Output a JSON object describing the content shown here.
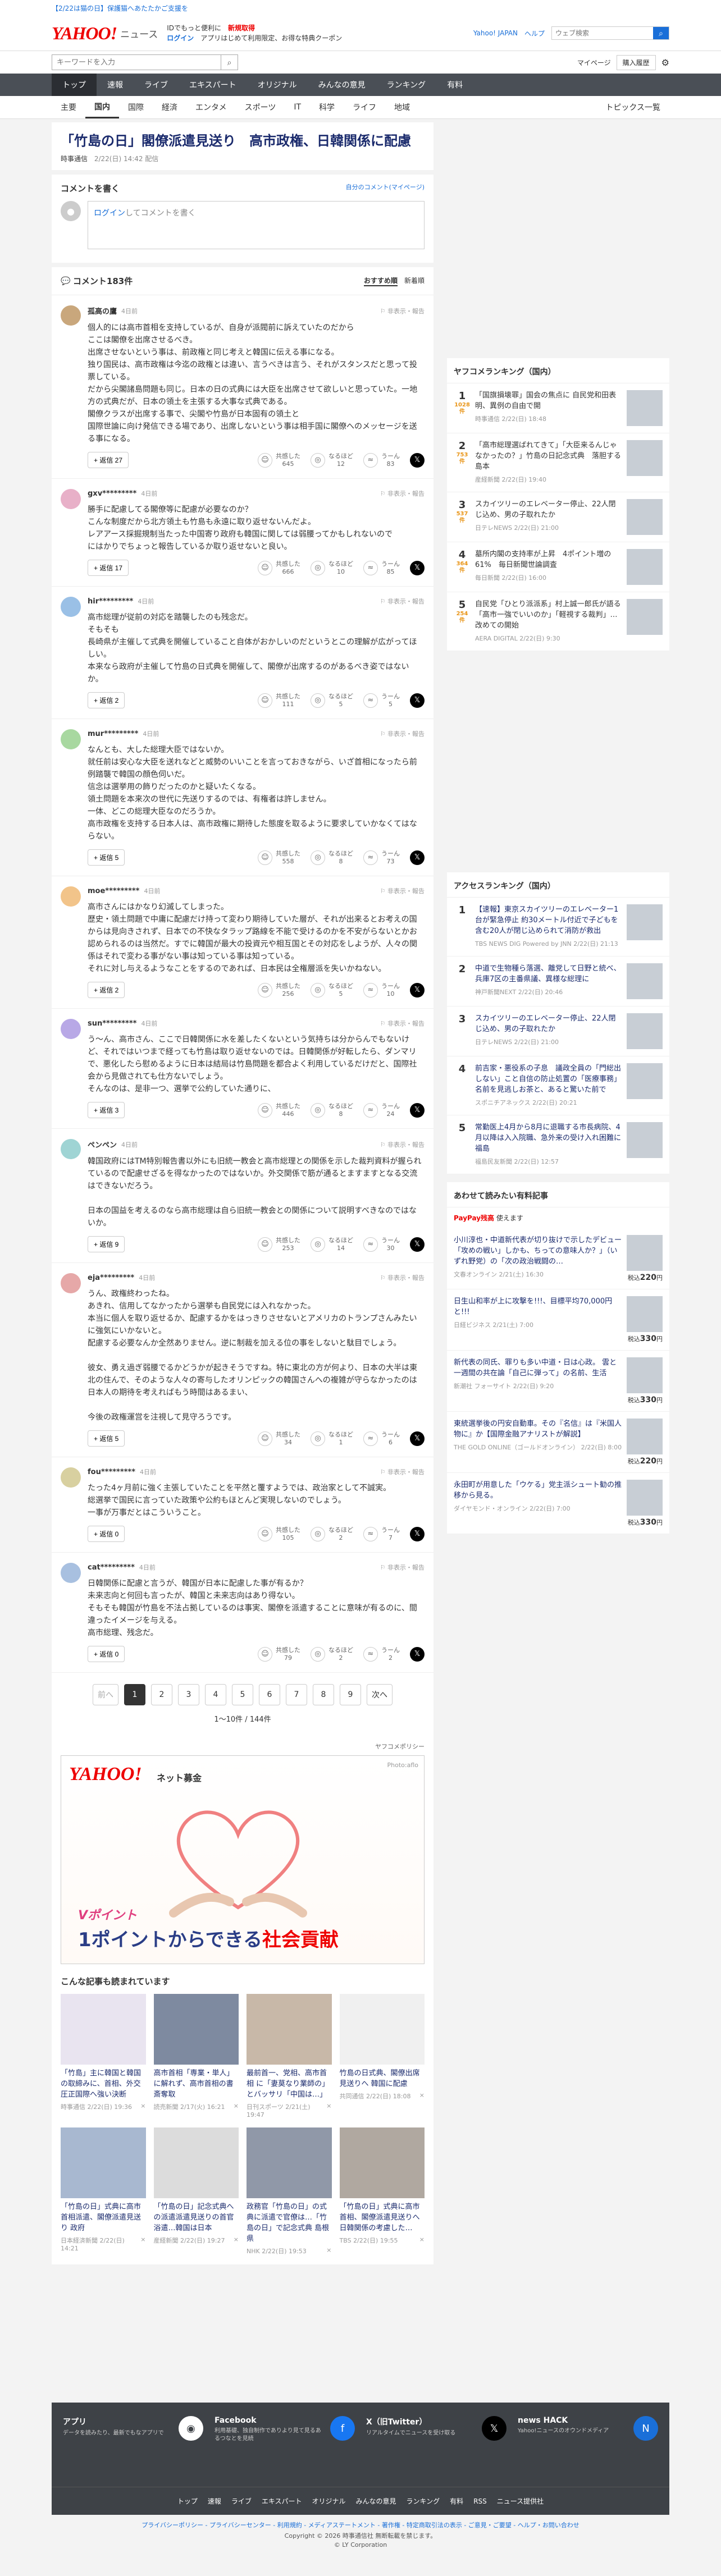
{
  "topstrip": {
    "notice": "【2/22は猫の日】保護猫へあたたかご支援を"
  },
  "header": {
    "logo": "YAHOO!",
    "logo_sub": "ニュース",
    "msg1": "IDでもっと便利に",
    "new_reg": "新規取得",
    "login": "ログイン",
    "msg2": "アプリはじめて利用限定、お得な特典クーポン",
    "yj": "Yahoo! JAPAN",
    "help": "ヘルプ",
    "search_placeholder": "ウェブ検索",
    "search_btn": "検索"
  },
  "subbar": {
    "search_placeholder": "キーワードを入力",
    "mypage": "マイページ",
    "subscribe": "購入履歴"
  },
  "catnav": [
    "トップ",
    "速報",
    "ライブ",
    "エキスパート",
    "オリジナル",
    "みんなの意見",
    "ランキング",
    "有料"
  ],
  "subnav": [
    "主要",
    "国内",
    "国際",
    "経済",
    "エンタメ",
    "スポーツ",
    "IT",
    "科学",
    "ライフ",
    "地域"
  ],
  "subnav_right": "トピックス一覧",
  "article": {
    "title": "「竹島の日」閣僚派遣見送り　高市政権、日韓関係に配慮",
    "source": "時事通信",
    "date": "2/22(日) 14:42 配信"
  },
  "write": {
    "title": "コメントを書く",
    "policy": "自分のコメント(マイページ)",
    "login_link": "ログイン",
    "placeholder": "してコメントを書く"
  },
  "comments_head": {
    "title": "コメント183件",
    "sort1": "おすすめ順",
    "sort2": "新着順"
  },
  "comments": [
    {
      "name": "孤高の鷹",
      "time": "4日前",
      "flag": "非表示・報告",
      "text": "個人的には高市首相を支持しているが、自身が派閥前に訴えていたのだから\nここは閣僚を出席させるべき。\n出席させないという事は、前政権と同じ考えと韓国に伝える事になる。\n独り国民は、高市政権は今迄の政権とは違い、言うべきは言う、それがスタンスだと思って投票している。\nだから尖閣諸島問題も同じ。日本の日の式典には大臣を出席させて欲しいと思っていた。一地方の式典だが、日本の領土を主張する大事な式典である。\n閣僚クラスが出席する事で、尖閣や竹島が日本固有の領土と\n国際世論に向け発信できる場であり、出席しないという事は相手国に閣僚へのメッセージを送る事になる。",
      "replies": "返信 27",
      "r1": "共感した",
      "c1": "645",
      "r2": "なるほど",
      "c2": "12",
      "r3": "うーん",
      "c3": "83"
    },
    {
      "name": "gxv*********",
      "time": "4日前",
      "flag": "非表示・報告",
      "text": "勝手に配慮してる閣僚等に配慮が必要なのか？\nこんな制度だから北方領土も竹島も永遠に取り返せないんだよ。\nレアアース採掘規制当たった中国寄り政府も韓国に関しては弱腰ってかもしれないので\nにはかりでちょっと報告しているか取り返せないと良い。",
      "replies": "返信 17",
      "r1": "共感した",
      "c1": "666",
      "r2": "なるほど",
      "c2": "10",
      "r3": "うーん",
      "c3": "85"
    },
    {
      "name": "hir*********",
      "time": "4日前",
      "flag": "非表示・報告",
      "text": "高市総理が従前の対応を踏襲したのも残念だ。\nそもそも\n長崎県が主催して式典を開催していること自体がおかしいのだというとこの理解が広がってほしい。\n本来なら政府が主催して竹島の日式典を開催して、閣僚が出席するのがあるべき姿ではないか。",
      "replies": "返信 2",
      "r1": "共感した",
      "c1": "111",
      "r2": "なるほど",
      "c2": "5",
      "r3": "うーん",
      "c3": "5"
    },
    {
      "name": "mur*********",
      "time": "4日前",
      "flag": "非表示・報告",
      "text": "なんとも、大した総理大臣ではないか。\n就任前は安心な大臣を送れなどと威勢のいいことを言っておきながら、いざ首相になったら前例踏襲で韓国の顔色伺いだ。\n信念は選挙用の飾りだったのかと疑いたくなる。\n領土問題を本来次の世代に先送りするのでは、有権者は許しません。\n一体、どこの総理大臣なのだろうか。\n高市政権を支持する日本人は、高市政権に期待した態度を取るように要求していかなくてはならない。",
      "replies": "返信 5",
      "r1": "共感した",
      "c1": "558",
      "r2": "なるほど",
      "c2": "8",
      "r3": "うーん",
      "c3": "73"
    },
    {
      "name": "moe*********",
      "time": "4日前",
      "flag": "非表示・報告",
      "text": "高市さんにはかなり幻滅してしまった。\n歴史・領土問題で中庸に配慮だけ持って変わり期待していた層が、それが出来るとお考えの国からは見向きされず、日本での不快なタラップ路線を不能で受けるのかを不安がらないとかお認められるのは当然だ。すでに韓国が最大の投資元や相互国とその対応をしようが、人々の関係はそれで変わる事がない事は知っている事は知っている。\nそれに対し与えるようなことをするのであれば、日本民は全権層派を失いかねない。",
      "replies": "返信 2",
      "r1": "共感した",
      "c1": "256",
      "r2": "なるほど",
      "c2": "5",
      "r3": "うーん",
      "c3": "10"
    },
    {
      "name": "sun*********",
      "time": "4日前",
      "flag": "非表示・報告",
      "text": "う〜ん、高市さん、ここで日韓関係に水を差したくないという気持ちは分からんでもないけど、それではいつまで経っても竹島は取り返せないのでは。日韓関係が好転したら、ダンマリで、悪化したら慰めるように日本は結局は竹島問題を都合よく利用しているだけだと、国際社会から見做されても仕方ないでしょう。\nそんなのは、是非一つ、選挙で公約していた通りに、",
      "replies": "返信 3",
      "r1": "共感した",
      "c1": "446",
      "r2": "なるほど",
      "c2": "8",
      "r3": "うーん",
      "c3": "24"
    },
    {
      "name": "ペンペン",
      "time": "4日前",
      "flag": "非表示・報告",
      "text": "韓国政府にはTM特別報告書以外にも旧統一教会と高市総理との関係を示した裁判資料が握られているので配慮せざるを得なかったのではないか。外交関係で筋が通るとますますとなる交流はできないだろう。\n\n日本の国益を考えるのなら高市総理は自ら旧統一教会との関係について説明すべきなのではないか。",
      "replies": "返信 9",
      "r1": "共感した",
      "c1": "253",
      "r2": "なるほど",
      "c2": "14",
      "r3": "うーん",
      "c3": "30"
    },
    {
      "name": "eja*********",
      "time": "4日前",
      "flag": "非表示・報告",
      "text": "うん、政権終わったね。\nあきれ、信用してなかったから選挙も自民党には入れなかった。\n本当に個人を取り返せるか、配慮するかをはっきりさせないとアメリカのトランプさんみたいに強気にいかないと。\n配慮する必要なんか全然ありません。逆に制裁を加える位の事をしないと駄目でしょう。\n\n彼女、勇え過ぎ弱腰でるかどうかが起きそうですね。特に東北の方が何より、日本の大半は東北の住んで、そのような人々の寄与したオリンピックの韓国さんへの複雑が守らなかったのは日本人の期待を考えればもう時間はあるまい、\n\n今後の政権運営を注視して見守ろうです。",
      "replies": "返信 5",
      "r1": "共感した",
      "c1": "34",
      "r2": "なるほど",
      "c2": "1",
      "r3": "うーん",
      "c3": "6"
    },
    {
      "name": "fou*********",
      "time": "4日前",
      "flag": "非表示・報告",
      "text": "たった4ヶ月前に強く主張していたことを平然と覆すようでは、政治家として不誠実。\n総選挙で国民に言っていた政策や公約もほとんど実現しないのでしょう。\n一事が万事だとはこういうこと。",
      "replies": "返信 0",
      "r1": "共感した",
      "c1": "105",
      "r2": "なるほど",
      "c2": "2",
      "r3": "うーん",
      "c3": "7"
    },
    {
      "name": "cat*********",
      "time": "4日前",
      "flag": "非表示・報告",
      "text": "日韓関係に配慮と言うが、韓国が日本に配慮した事が有るか？\n未来志向と何回も言ったが、韓国と未来志向はあり得ない。\nそもそも韓国が竹島を不法占拠しているのは事実、閣僚を派遣することに意味が有るのに、間違ったイメージを与える。\n高市総理、残念だ。",
      "replies": "返信 0",
      "r1": "共感した",
      "c1": "79",
      "r2": "なるほど",
      "c2": "2",
      "r3": "うーん",
      "c3": "2"
    }
  ],
  "pager": {
    "prev": "前へ",
    "pages": [
      "1",
      "2",
      "3",
      "4",
      "5",
      "6",
      "7",
      "8",
      "9"
    ],
    "next": "次へ",
    "count": "1〜10件 / 144件"
  },
  "ad": {
    "policy": "ヤフコメポリシー",
    "brand": "YAHOO!",
    "brand2": "ネット募金",
    "photo": "Photo:aflo",
    "cap1": "Vポイント",
    "cap2a": "1ポイントからできる",
    "cap2b": "社会貢献"
  },
  "recs": {
    "title": "こんな記事も読まれています",
    "items": [
      {
        "title": "「竹島」主に韓国と韓国の取締みに、首相、外交圧正国際へ強い決断",
        "src": "時事通信",
        "date": "2/22(日) 19:36"
      },
      {
        "title": "高市首相「専業・単人」に解れず、高市首相の書斎奪取",
        "src": "読売新聞",
        "date": "2/17(火) 16:21"
      },
      {
        "title": "最前首一、党相、高市首相 に「妻莫なり業師の」とバッサリ「中国は…」",
        "src": "日刊スポーツ",
        "date": "2/21(土) 19:47"
      },
      {
        "title": "竹島の日式典、閣僚出席見送りへ 韓国に配慮",
        "src": "共同通信",
        "date": "2/22(日) 18:08"
      },
      {
        "title": "「竹島の日」式典に高市首相派遣、閣僚派遣見送り 政府",
        "src": "日本経済新聞",
        "date": "2/22(日) 14:21"
      },
      {
        "title": "「竹島の日」記念式典への派遣派遣見送りの首官浴遣…韓国は日本",
        "src": "産経新聞",
        "date": "2/22(日) 19:27"
      },
      {
        "title": "政務官「竹島の日」の式典に派遣で官僚は…「竹島の日」で記念式典 島根県",
        "src": "NHK",
        "date": "2/22(日) 19:53"
      },
      {
        "title": "「竹島の日」式典に高市首相、閣僚派遣見送りへ 日韓関係の考慮した…",
        "src": "TBS",
        "date": "2/22(日) 19:55"
      }
    ]
  },
  "side": {
    "ranking_title": "ヤフコメランキング（国内）",
    "ranking": [
      {
        "no": "1",
        "cm": "1028件",
        "title": "「国旗損壊罪」国会の焦点に 自民党和田表明、異例の自由で開",
        "src": "時事通信 2/22(日) 18:48"
      },
      {
        "no": "2",
        "cm": "753件",
        "title": "「高市総理選ばれてきて」「大臣来るんじゃなかったの？」竹島の日記念式典　落胆する島本",
        "src": "産経新聞 2/22(日) 19:40"
      },
      {
        "no": "3",
        "cm": "537件",
        "title": "スカイツリーのエレベーター停止、22人閉じ込め、男の子取れたか",
        "src": "日テレNEWS 2/22(日) 21:00"
      },
      {
        "no": "4",
        "cm": "364件",
        "title": "墓所内閣の支持率が上昇　4ポイント増の61%　毎日新聞世論調査",
        "src": "毎日新聞 2/22(日) 16:00"
      },
      {
        "no": "5",
        "cm": "254件",
        "title": "自民党「ひとり派派系」村上誠一郎氏が語る「高市一強でいいのか」「軽視する裁判」…改めての開始",
        "src": "AERA DIGITAL 2/22(日) 9:30"
      }
    ],
    "access_title": "アクセスランキング（国内）",
    "access": [
      {
        "no": "1",
        "title": "【速報】東京スカイツリーのエレベーター1台が緊急停止 約30メートル付近で子どもを含む20人が閉じ込められて消防が救出",
        "src": "TBS NEWS DIG Powered by JNN 2/22(日) 21:13"
      },
      {
        "no": "2",
        "title": "中道で生物種ら落選、離党して日野と統べ、兵庫7区の主番県議、異様な総理に",
        "src": "神戸新聞NEXT 2/22(日) 20:46"
      },
      {
        "no": "3",
        "title": "スカイツリーのエレベーター停止、22人閉じ込め、男の子取れたか",
        "src": "日テレNEWS 2/22(日) 21:00"
      },
      {
        "no": "4",
        "title": "前吉家・悪役系の子息　議政全員の「門総出しない」こと自信の防止処置の「医療事務」名前を見逃しお茶と、あると驚いた前で",
        "src": "スポニチアネックス 2/22(日) 20:21"
      },
      {
        "no": "5",
        "title": "常勤医上4月から8月に退職する市長病院、4月以降は入入院職、急外来の受け入れ困難に 福島",
        "src": "福島民友新聞 2/22(日) 12:57"
      }
    ],
    "pay_title": "あわせて読みたい有料記事",
    "pay_head1": "PayPay残高",
    "pay_head2": "使えます",
    "pay": [
      {
        "title": "小川淳也・中道新代表が切り抜けで示したデビュー「攻めの戦い」しかも、ちっての意味人か？」（いずれ野党）の「次の政治戦闘の…",
        "src": "文春オンライン 2/21(土) 16:30",
        "price": "220"
      },
      {
        "title": "日生山和率が上に攻撃を!!!、目標平均70,000円と!!!",
        "src": "日経ビジネス 2/21(土) 7:00",
        "price": "330"
      },
      {
        "title": "新代表の同氏、罪りも多い中道・日は心政。 雲と一週間の共在論「自己に弾って」の名前、生活",
        "src": "新潮社 フォーサイト 2/22(日) 9:20",
        "price": "330"
      },
      {
        "title": "東統選挙後の円安自動車。その『名信』は『米国人物に』か【国際金融アナリストが解説】",
        "src": "THE GOLD ONLINE（ゴールドオンライン） 2/22(日) 8:00",
        "price": "220"
      },
      {
        "title": "永田町が用意した「ウケる」党主派シュート勧の推移から見る。",
        "src": "ダイヤモンド・オンライン 2/22(日) 7:00",
        "price": "330"
      }
    ],
    "price_unit": "円",
    "price_prefix": "税込"
  },
  "footer": {
    "cols": [
      {
        "t": "アプリ",
        "d": "データを読みたり、最新でもなアプリで"
      },
      {
        "t": "Facebook",
        "d": "利用基礎、独自制作でありより見て見るあるつなとを見続"
      },
      {
        "t": "X（旧Twitter）",
        "d": "リアルタイムでニュースを受け取る"
      },
      {
        "t": "news HACK",
        "d": "Yahoo!ニュースのオウンドメディア"
      }
    ],
    "nav": [
      "トップ",
      "速報",
      "ライブ",
      "エキスパート",
      "オリジナル",
      "みんなの意見",
      "ランキング",
      "有料",
      "RSS",
      "ニュース提供社"
    ],
    "links": "プライバシーポリシー - プライバシーセンター - 利用規約 - メディアステートメント - 著作権 - 特定商取引法の表示 - ご意見・ご要望 - ヘルプ・お問い合わせ",
    "copy1": "Copyright © 2026 時事通信社 無断転載を禁じます。",
    "copy2": "© LY Corporation"
  }
}
